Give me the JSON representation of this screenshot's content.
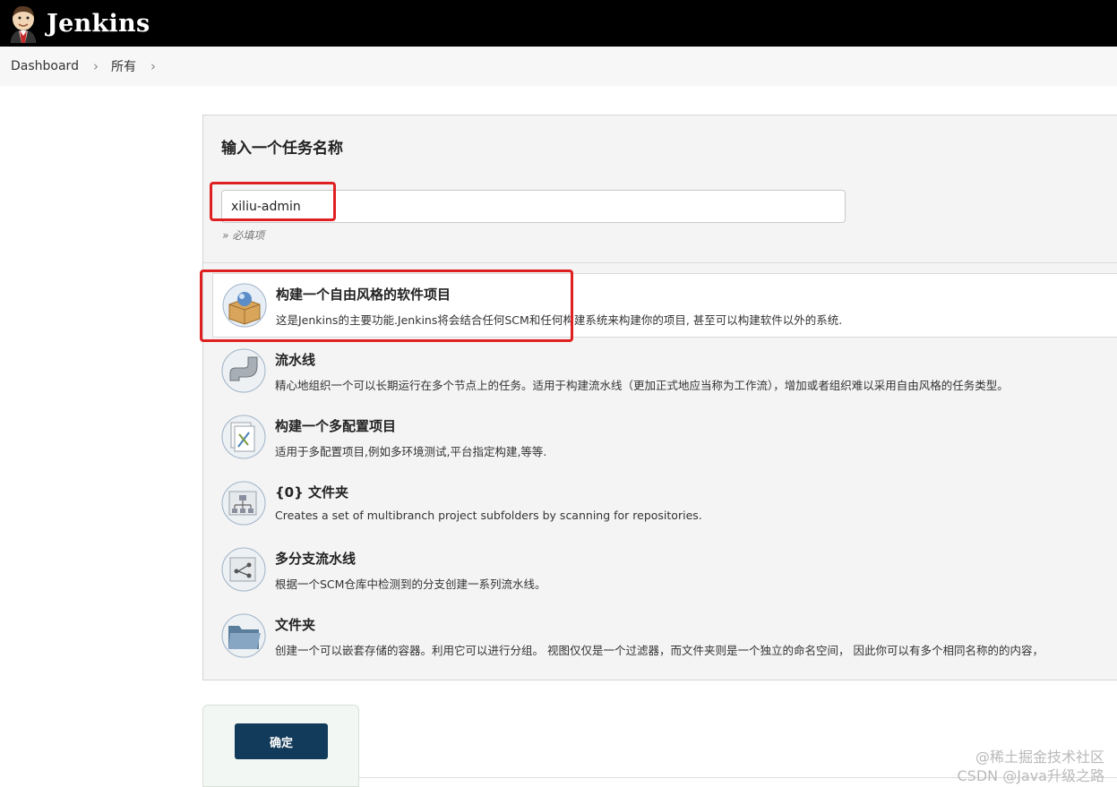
{
  "header": {
    "logo_text": "Jenkins"
  },
  "breadcrumb": {
    "items": [
      "Dashboard",
      "所有"
    ]
  },
  "form": {
    "title": "输入一个任务名称",
    "name_value": "xiliu-admin",
    "required_hint": "» 必填项"
  },
  "job_types": [
    {
      "icon": "freestyle-box-icon",
      "title": "构建一个自由风格的软件项目",
      "desc": "这是Jenkins的主要功能.Jenkins将会结合任何SCM和任何构建系统来构建你的项目, 甚至可以构建软件以外的系统.",
      "selected": true
    },
    {
      "icon": "pipeline-pipe-icon",
      "title": "流水线",
      "desc": "精心地组织一个可以长期运行在多个节点上的任务。适用于构建流水线（更加正式地应当称为工作流），增加或者组织难以采用自由风格的任务类型。",
      "selected": false
    },
    {
      "icon": "multi-config-icon",
      "title": "构建一个多配置项目",
      "desc": "适用于多配置项目,例如多环境测试,平台指定构建,等等.",
      "selected": false
    },
    {
      "icon": "org-folder-icon",
      "title": "{0} 文件夹",
      "desc": "Creates a set of multibranch project subfolders by scanning for repositories.",
      "selected": false
    },
    {
      "icon": "multibranch-icon",
      "title": "多分支流水线",
      "desc": "根据一个SCM仓库中检测到的分支创建一系列流水线。",
      "selected": false
    },
    {
      "icon": "folder-icon",
      "title": "文件夹",
      "desc": "创建一个可以嵌套存储的容器。利用它可以进行分组。 视图仅仅是一个过滤器，而文件夹则是一个独立的命名空间， 因此你可以有多个相同名称的的内容，",
      "selected": false
    }
  ],
  "footer": {
    "ok_label": "确定"
  },
  "watermark": {
    "line1": "@稀土掘金技术社区",
    "line2": "CSDN @Java升级之路"
  },
  "colors": {
    "header_bg": "#000000",
    "button_bg": "#123a5a",
    "annotation": "#e02020"
  }
}
